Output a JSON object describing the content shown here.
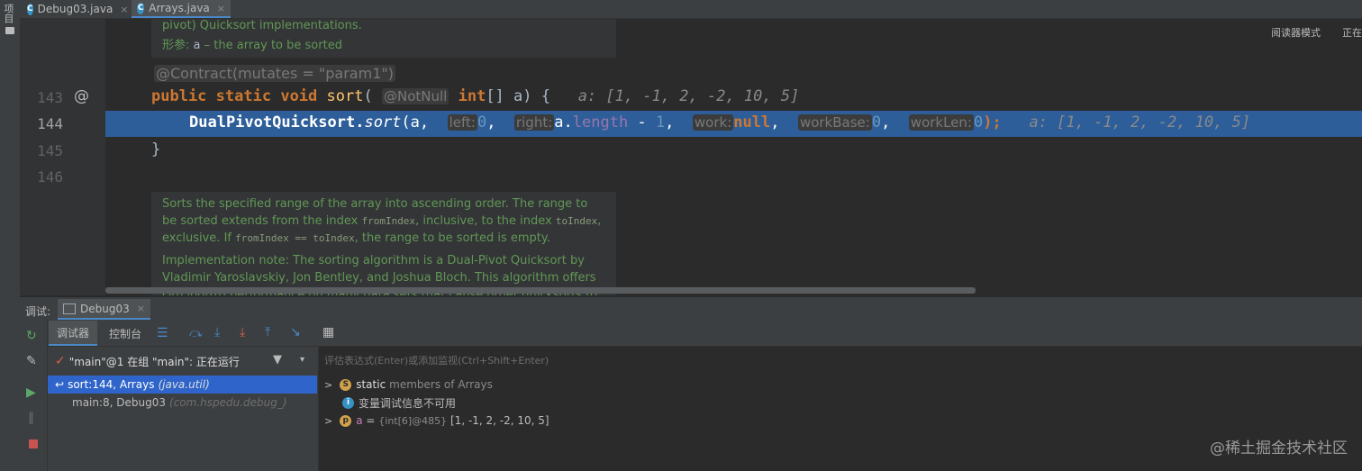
{
  "sidebar": {
    "project_label": "项目"
  },
  "tabs": [
    {
      "label": "Debug03.java",
      "close": "×",
      "active": false
    },
    {
      "label": "Arrays.java",
      "close": "×",
      "active": true
    }
  ],
  "editor": {
    "reader_mode": "阅读器模式",
    "reader_right": "正在",
    "doc_top": {
      "line1": "pivot) Quicksort implementations.",
      "param_label": "形参:",
      "param_name": "a",
      "param_desc": "– the array to be sorted"
    },
    "contract": "@Contract(mutates = \"param1\")",
    "lines": [
      {
        "num": "143",
        "marker": "@"
      },
      {
        "num": "144"
      },
      {
        "num": "145"
      },
      {
        "num": "146"
      }
    ],
    "line143": {
      "public": "public",
      "static": "static",
      "void": "void",
      "sort": "sort",
      "open": "(",
      "notnull": "@NotNull",
      "int": "int",
      "rest": "[] a) {",
      "inline": "a: [1, -1, 2, -2, 10, 5]"
    },
    "line144": {
      "call": "DualPivotQuicksort.",
      "method": "sort",
      "arg_a": "(a,",
      "hint_left": "left:",
      "zero1": "0",
      "comma1": ",",
      "hint_right": "right:",
      "a": "a.",
      "length": "length",
      "minus": " - ",
      "one": "1",
      "comma2": ",",
      "hint_work": "work:",
      "null": "null",
      "comma3": ",",
      "hint_workbase": "workBase:",
      "zero2": "0",
      "comma4": ",",
      "hint_worklen": "workLen:",
      "zero3": "0",
      "close": ");",
      "inline": "a: [1, -1, 2, -2, 10, 5]"
    },
    "line145": {
      "brace": "}"
    },
    "doc_bottom": {
      "p1_a": "Sorts the specified range of the array into ascending order. The range to be sorted extends from the index",
      "p1_code1": "fromIndex",
      "p1_b": ", inclusive, to the index",
      "p1_code2": "toIndex",
      "p1_c": ", exclusive. If",
      "p1_code3": "fromIndex == toIndex",
      "p1_d": ", the range to be sorted is empty.",
      "p2": "Implementation note: The sorting algorithm is a Dual-Pivot Quicksort by Vladimir Yaroslavskiy, Jon Bentley, and Joshua Bloch. This algorithm offers O(n log(n)) performance on many data sets that cause other quicksorts to"
    }
  },
  "debug": {
    "title": "调试:",
    "session": "Debug03",
    "tabs": [
      "调试器",
      "控制台"
    ],
    "thread": "\"main\"@1 在组 \"main\": 正在运行",
    "expression_placeholder": "评估表达式(Enter)或添加监视(Ctrl+Shift+Enter)",
    "frames": [
      {
        "method": "sort:144, Arrays",
        "pkg": "(java.util)"
      },
      {
        "method": "main:8, Debug03",
        "pkg": "(com.hspedu.debug_)"
      }
    ],
    "vars": [
      {
        "badge": "S",
        "name": "static",
        "desc": "members of Arrays"
      },
      {
        "badge": "i",
        "name": "",
        "desc": "变量调试信息不可用"
      },
      {
        "badge": "p",
        "name": "a",
        "eq": " = ",
        "ref": "{int[6]@485}",
        "value": " [1, -1, 2, -2, 10, 5]"
      }
    ],
    "watermark": "@稀土掘金技术社区"
  },
  "colors": {
    "accent": "#4a88c7",
    "exec_line": "#2d5e99",
    "keyword": "#cc7832",
    "doc_text": "#629755"
  }
}
